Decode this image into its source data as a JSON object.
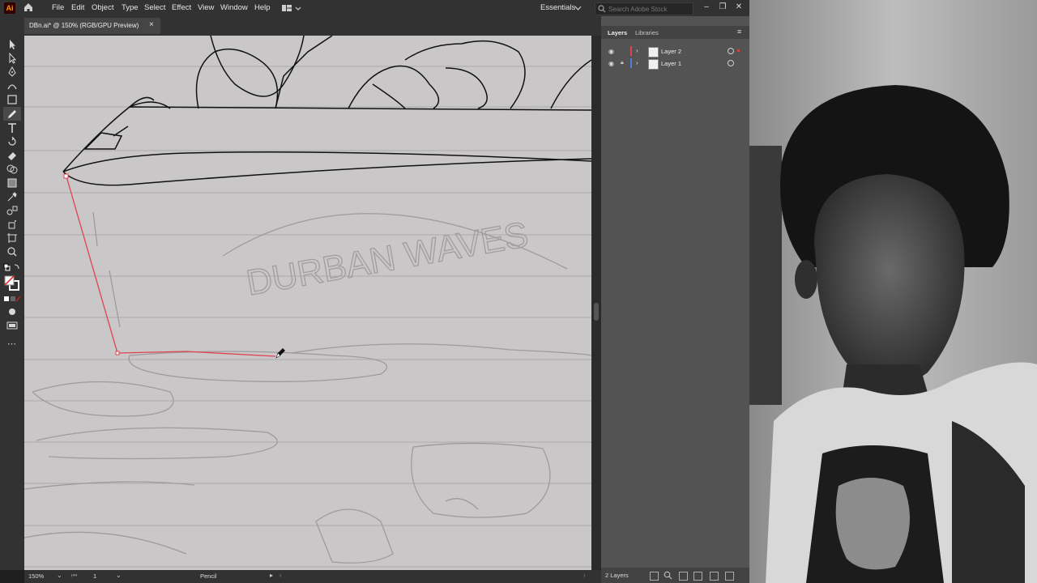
{
  "app": {
    "logo_text": "Ai"
  },
  "menu": [
    "File",
    "Edit",
    "Object",
    "Type",
    "Select",
    "Effect",
    "View",
    "Window",
    "Help"
  ],
  "workspace_label": "Essentials",
  "search": {
    "placeholder": "Search Adobe Stock"
  },
  "document": {
    "tab_title": "DBn.ai* @ 150% (RGB/GPU Preview)",
    "close_glyph": "×"
  },
  "artwork_text": "DURBAN WAVES",
  "layers_panel": {
    "tabs": [
      "Layers",
      "Libraries"
    ],
    "layers": [
      {
        "name": "Layer 2",
        "color": "#e0424f",
        "selected": true,
        "locked": false
      },
      {
        "name": "Layer 1",
        "color": "#4f7ee0",
        "selected": false,
        "locked": true
      }
    ],
    "count_label": "2 Layers"
  },
  "status": {
    "zoom": "150%",
    "artboard": "1",
    "tool": "Pencil"
  },
  "colors": {
    "ui_dark": "#323232",
    "panel": "#535353",
    "canvas": "#c9c7c8",
    "path_red": "#e0424f"
  },
  "icons": [
    "home-icon",
    "search-icon",
    "minimize-icon",
    "restore-icon",
    "close-icon",
    "eye-icon",
    "lock-icon",
    "chevron-right-icon",
    "pencil-cursor-icon"
  ]
}
